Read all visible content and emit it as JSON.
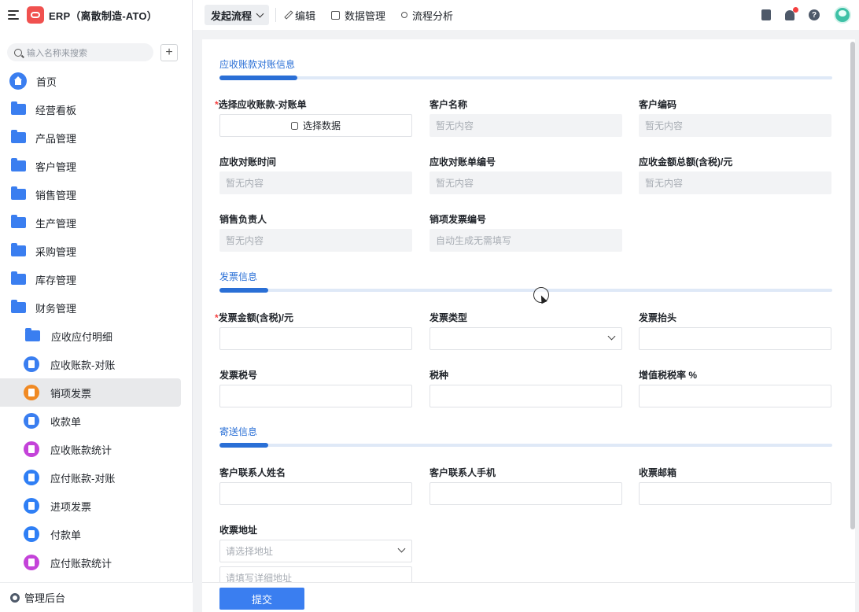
{
  "app": {
    "title": "ERP（离散制造-ATO）"
  },
  "search": {
    "placeholder": "输入名称来搜索",
    "add_label": "+"
  },
  "sidebar": {
    "items": [
      {
        "label": "首页",
        "icon": "home-icon"
      },
      {
        "label": "经营看板",
        "icon": "folder-icon"
      },
      {
        "label": "产品管理",
        "icon": "folder-icon"
      },
      {
        "label": "客户管理",
        "icon": "folder-icon"
      },
      {
        "label": "销售管理",
        "icon": "folder-icon"
      },
      {
        "label": "生产管理",
        "icon": "folder-icon"
      },
      {
        "label": "采购管理",
        "icon": "folder-icon"
      },
      {
        "label": "库存管理",
        "icon": "folder-icon"
      },
      {
        "label": "财务管理",
        "icon": "folder-open-icon"
      }
    ],
    "sub_items": [
      {
        "label": "应收应付明细",
        "icon": "folder-icon"
      },
      {
        "label": "应收账款-对账",
        "icon": "document-icon"
      },
      {
        "label": "销项发票",
        "icon": "invoice-icon",
        "active": true
      },
      {
        "label": "收款单",
        "icon": "document-icon"
      },
      {
        "label": "应收账款统计",
        "icon": "chart-icon"
      },
      {
        "label": "应付账款-对账",
        "icon": "upload-icon"
      },
      {
        "label": "进项发票",
        "icon": "card-icon"
      },
      {
        "label": "付款单",
        "icon": "upload-icon"
      },
      {
        "label": "应付账款统计",
        "icon": "chart-icon"
      }
    ],
    "footer_label": "管理后台"
  },
  "toolbar": {
    "start_flow": "发起流程",
    "edit": "编辑",
    "data_manage": "数据管理",
    "flow_analysis": "流程分析"
  },
  "form": {
    "sections": {
      "reconcile": "应收账款对账信息",
      "invoice": "发票信息",
      "mailing": "寄送信息"
    },
    "empty_text": "暂无内容",
    "auto_text": "自动生成无需填写",
    "select_data": "选择数据",
    "required_mark": "*",
    "fields": {
      "select_reconcile": "选择应收账款-对账单",
      "customer_name": "客户名称",
      "customer_code": "客户编码",
      "reconcile_time": "应收对账时间",
      "reconcile_no": "应收对账单编号",
      "amount_total": "应收金额总额(含税)/元",
      "sales_owner": "销售负责人",
      "invoice_no": "销项发票编号",
      "invoice_amount": "发票金额(含税)/元",
      "invoice_type": "发票类型",
      "invoice_header": "发票抬头",
      "tax_no": "发票税号",
      "tax_kind": "税种",
      "vat_rate": "增值税税率 %",
      "contact_name": "客户联系人姓名",
      "contact_phone": "客户联系人手机",
      "invoice_email": "收票邮箱",
      "invoice_address": "收票地址"
    },
    "address_placeholder": "请选择地址",
    "address_detail_placeholder": "请填写详细地址",
    "submit": "提交"
  },
  "colors": {
    "accent": "#2a6fd6",
    "button": "#3a7ef0",
    "required": "#f53f3f"
  }
}
